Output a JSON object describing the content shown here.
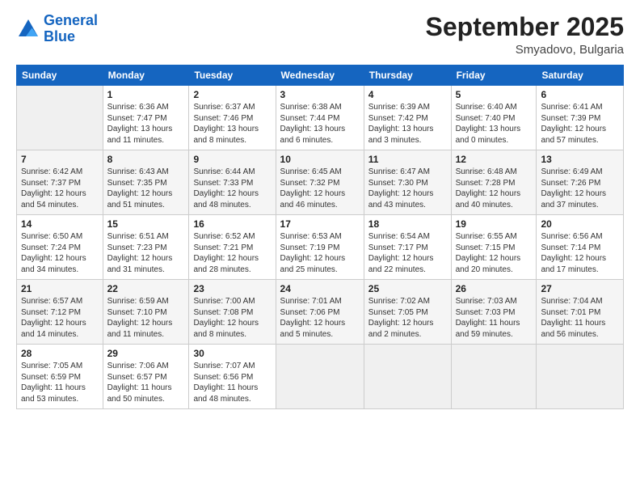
{
  "logo": {
    "line1": "General",
    "line2": "Blue"
  },
  "header": {
    "month": "September 2025",
    "location": "Smyadovo, Bulgaria"
  },
  "weekdays": [
    "Sunday",
    "Monday",
    "Tuesday",
    "Wednesday",
    "Thursday",
    "Friday",
    "Saturday"
  ],
  "weeks": [
    [
      {
        "day": "",
        "info": ""
      },
      {
        "day": "1",
        "info": "Sunrise: 6:36 AM\nSunset: 7:47 PM\nDaylight: 13 hours\nand 11 minutes."
      },
      {
        "day": "2",
        "info": "Sunrise: 6:37 AM\nSunset: 7:46 PM\nDaylight: 13 hours\nand 8 minutes."
      },
      {
        "day": "3",
        "info": "Sunrise: 6:38 AM\nSunset: 7:44 PM\nDaylight: 13 hours\nand 6 minutes."
      },
      {
        "day": "4",
        "info": "Sunrise: 6:39 AM\nSunset: 7:42 PM\nDaylight: 13 hours\nand 3 minutes."
      },
      {
        "day": "5",
        "info": "Sunrise: 6:40 AM\nSunset: 7:40 PM\nDaylight: 13 hours\nand 0 minutes."
      },
      {
        "day": "6",
        "info": "Sunrise: 6:41 AM\nSunset: 7:39 PM\nDaylight: 12 hours\nand 57 minutes."
      }
    ],
    [
      {
        "day": "7",
        "info": "Sunrise: 6:42 AM\nSunset: 7:37 PM\nDaylight: 12 hours\nand 54 minutes."
      },
      {
        "day": "8",
        "info": "Sunrise: 6:43 AM\nSunset: 7:35 PM\nDaylight: 12 hours\nand 51 minutes."
      },
      {
        "day": "9",
        "info": "Sunrise: 6:44 AM\nSunset: 7:33 PM\nDaylight: 12 hours\nand 48 minutes."
      },
      {
        "day": "10",
        "info": "Sunrise: 6:45 AM\nSunset: 7:32 PM\nDaylight: 12 hours\nand 46 minutes."
      },
      {
        "day": "11",
        "info": "Sunrise: 6:47 AM\nSunset: 7:30 PM\nDaylight: 12 hours\nand 43 minutes."
      },
      {
        "day": "12",
        "info": "Sunrise: 6:48 AM\nSunset: 7:28 PM\nDaylight: 12 hours\nand 40 minutes."
      },
      {
        "day": "13",
        "info": "Sunrise: 6:49 AM\nSunset: 7:26 PM\nDaylight: 12 hours\nand 37 minutes."
      }
    ],
    [
      {
        "day": "14",
        "info": "Sunrise: 6:50 AM\nSunset: 7:24 PM\nDaylight: 12 hours\nand 34 minutes."
      },
      {
        "day": "15",
        "info": "Sunrise: 6:51 AM\nSunset: 7:23 PM\nDaylight: 12 hours\nand 31 minutes."
      },
      {
        "day": "16",
        "info": "Sunrise: 6:52 AM\nSunset: 7:21 PM\nDaylight: 12 hours\nand 28 minutes."
      },
      {
        "day": "17",
        "info": "Sunrise: 6:53 AM\nSunset: 7:19 PM\nDaylight: 12 hours\nand 25 minutes."
      },
      {
        "day": "18",
        "info": "Sunrise: 6:54 AM\nSunset: 7:17 PM\nDaylight: 12 hours\nand 22 minutes."
      },
      {
        "day": "19",
        "info": "Sunrise: 6:55 AM\nSunset: 7:15 PM\nDaylight: 12 hours\nand 20 minutes."
      },
      {
        "day": "20",
        "info": "Sunrise: 6:56 AM\nSunset: 7:14 PM\nDaylight: 12 hours\nand 17 minutes."
      }
    ],
    [
      {
        "day": "21",
        "info": "Sunrise: 6:57 AM\nSunset: 7:12 PM\nDaylight: 12 hours\nand 14 minutes."
      },
      {
        "day": "22",
        "info": "Sunrise: 6:59 AM\nSunset: 7:10 PM\nDaylight: 12 hours\nand 11 minutes."
      },
      {
        "day": "23",
        "info": "Sunrise: 7:00 AM\nSunset: 7:08 PM\nDaylight: 12 hours\nand 8 minutes."
      },
      {
        "day": "24",
        "info": "Sunrise: 7:01 AM\nSunset: 7:06 PM\nDaylight: 12 hours\nand 5 minutes."
      },
      {
        "day": "25",
        "info": "Sunrise: 7:02 AM\nSunset: 7:05 PM\nDaylight: 12 hours\nand 2 minutes."
      },
      {
        "day": "26",
        "info": "Sunrise: 7:03 AM\nSunset: 7:03 PM\nDaylight: 11 hours\nand 59 minutes."
      },
      {
        "day": "27",
        "info": "Sunrise: 7:04 AM\nSunset: 7:01 PM\nDaylight: 11 hours\nand 56 minutes."
      }
    ],
    [
      {
        "day": "28",
        "info": "Sunrise: 7:05 AM\nSunset: 6:59 PM\nDaylight: 11 hours\nand 53 minutes."
      },
      {
        "day": "29",
        "info": "Sunrise: 7:06 AM\nSunset: 6:57 PM\nDaylight: 11 hours\nand 50 minutes."
      },
      {
        "day": "30",
        "info": "Sunrise: 7:07 AM\nSunset: 6:56 PM\nDaylight: 11 hours\nand 48 minutes."
      },
      {
        "day": "",
        "info": ""
      },
      {
        "day": "",
        "info": ""
      },
      {
        "day": "",
        "info": ""
      },
      {
        "day": "",
        "info": ""
      }
    ]
  ]
}
